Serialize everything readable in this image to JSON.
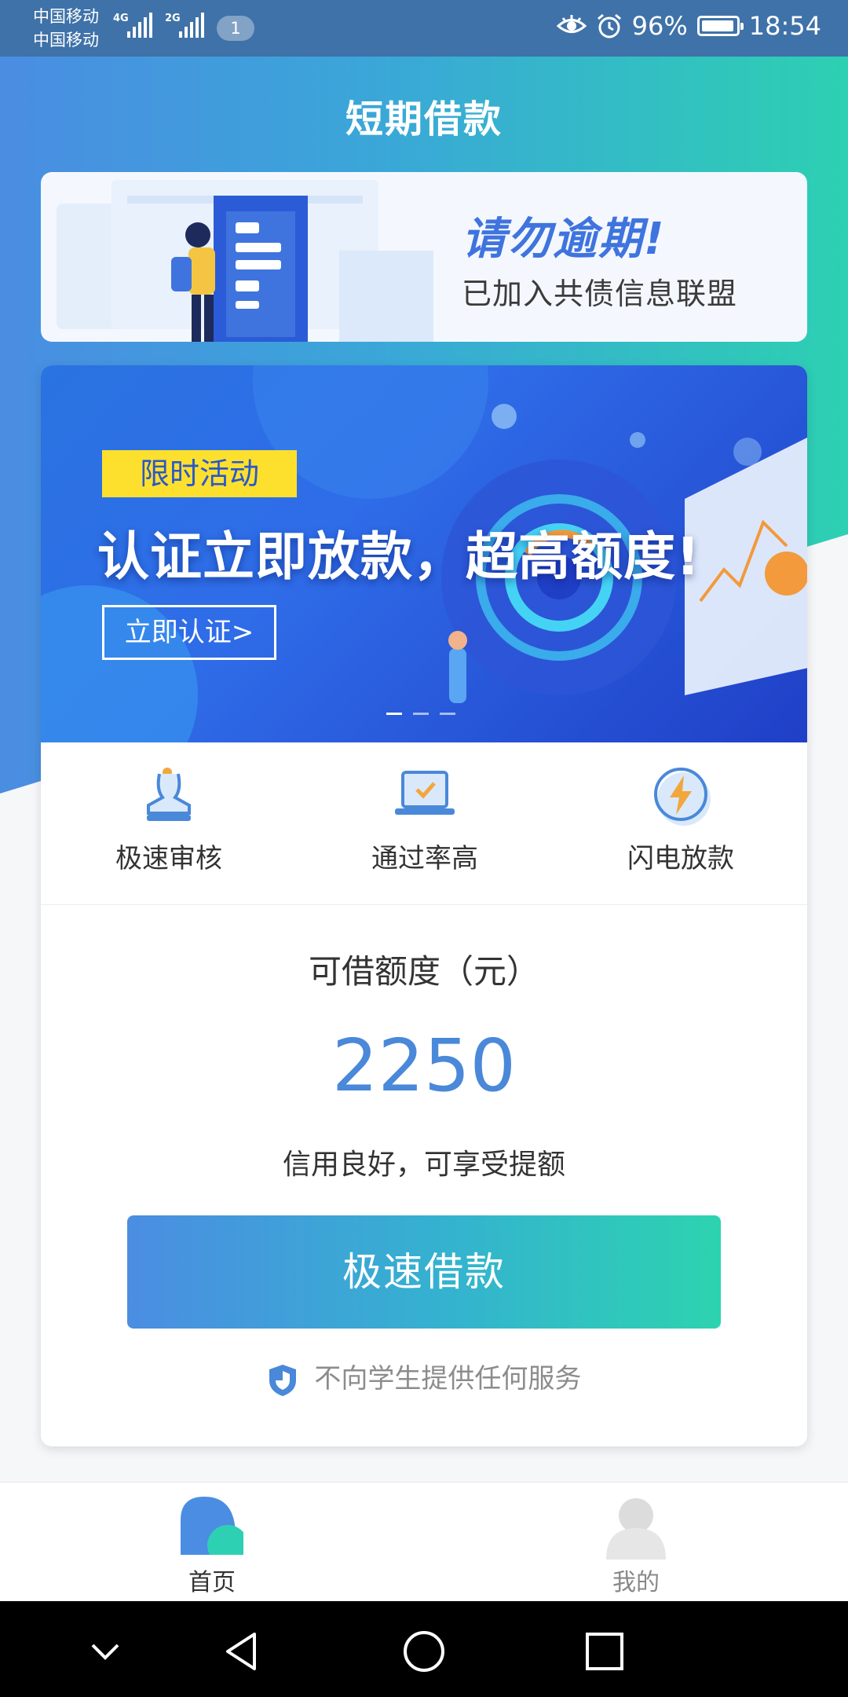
{
  "status_bar": {
    "carrier_1": "中国移动",
    "carrier_2": "中国移动",
    "network_1": "4G",
    "network_2": "2G",
    "notification_count": "1",
    "battery": "96%",
    "time": "18:54",
    "battery_level": 0.96
  },
  "header": {
    "title": "短期借款"
  },
  "notice": {
    "title": "请勿逾期!",
    "subtitle": "已加入共债信息联盟"
  },
  "promo": {
    "tag": "限时活动",
    "headline": "认证立即放款，超高额度!",
    "cta": "立即认证>",
    "slide_count": 3,
    "active_slide": 1
  },
  "features": [
    {
      "label": "极速审核",
      "icon": "stamp-icon"
    },
    {
      "label": "通过率高",
      "icon": "laptop-check-icon"
    },
    {
      "label": "闪电放款",
      "icon": "lightning-icon"
    }
  ],
  "loan": {
    "limit_label": "可借额度（元）",
    "limit_value": "2250",
    "credit_note": "信用良好，可享受提额",
    "button_label": "极速借款",
    "disclaimer": "不向学生提供任何服务"
  },
  "tabbar": {
    "items": [
      {
        "label": "首页",
        "active": true,
        "icon": "home-icon"
      },
      {
        "label": "我的",
        "active": false,
        "icon": "profile-icon"
      }
    ]
  },
  "colors": {
    "accent_blue": "#4a88d9",
    "gradient_start": "#4a8de2",
    "gradient_end": "#2dd0b2",
    "tag_yellow": "#fde02d"
  }
}
